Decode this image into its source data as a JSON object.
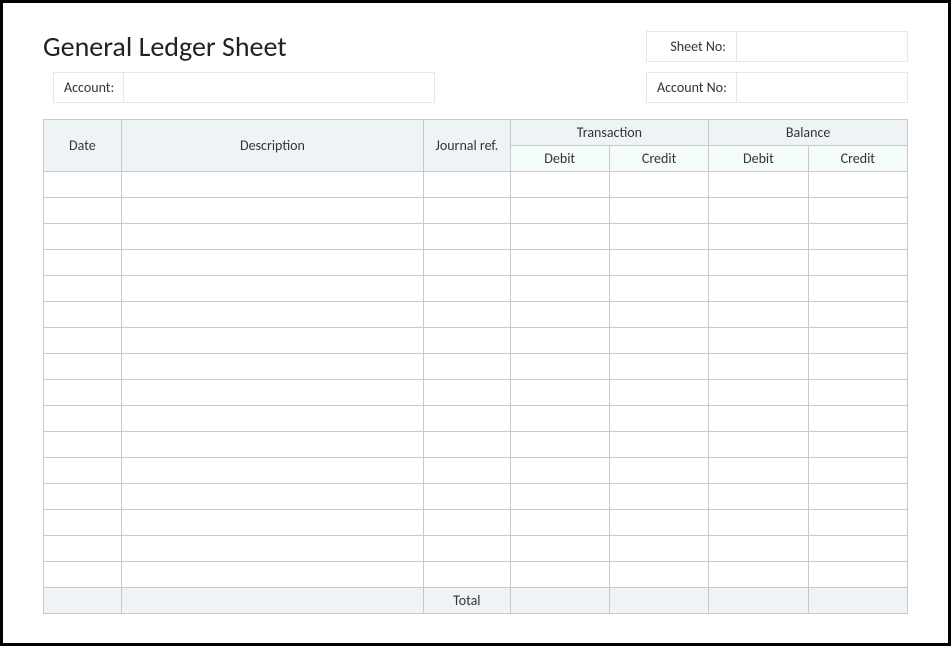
{
  "title": "General Ledger Sheet",
  "fields": {
    "sheet_no_label": "Sheet No:",
    "sheet_no_value": "",
    "account_label": "Account:",
    "account_value": "",
    "account_no_label": "Account No:",
    "account_no_value": ""
  },
  "columns": {
    "date": "Date",
    "description": "Description",
    "journal_ref": "Journal ref.",
    "transaction": "Transaction",
    "balance": "Balance",
    "debit": "Debit",
    "credit": "Credit"
  },
  "row_count": 16,
  "footer": {
    "total_label": "Total"
  }
}
